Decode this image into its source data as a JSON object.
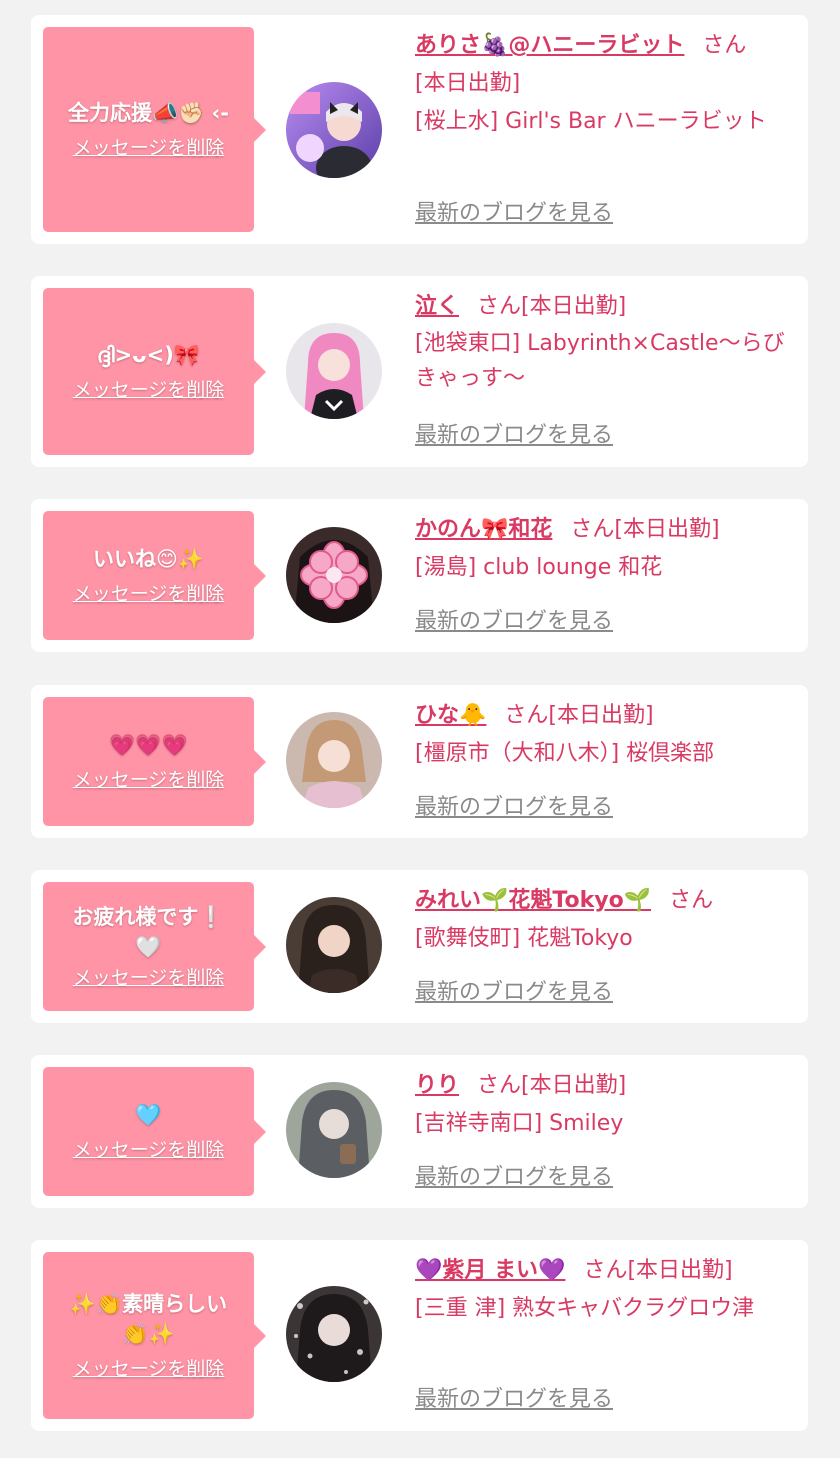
{
  "delete_label": "メッセージを削除",
  "blog_label": "最新のブログを見る",
  "colors": {
    "bubble": "#ff94a6",
    "name": "#d93a63",
    "blog": "#8a8a8a"
  },
  "entries": [
    {
      "message": "全力応援📣✊🏻 ‹-",
      "name": "ありさ🍇@ハニーラビット",
      "san": "さん",
      "line1": "[本日出勤]",
      "line2": "[桜上水] Girl's Bar ハニーラビット"
    },
    {
      "message": "ദ്ദി>ᴗ<)🎀",
      "name": "泣く",
      "san": "さん[本日出勤]",
      "line1": "",
      "line2": "[池袋東口] Labyrinth×Castle〜らびきゃっす〜"
    },
    {
      "message": "いいね😊✨",
      "name": "かのん🎀和花",
      "san": "さん[本日出勤]",
      "line1": "",
      "line2": "[湯島] club lounge 和花"
    },
    {
      "message": "💗💗💗",
      "name": "ひな🐥",
      "san": "さん[本日出勤]",
      "line1": "",
      "line2": "[橿原市（大和八木）] 桜倶楽部"
    },
    {
      "message": "お疲れ様です❕🤍",
      "name": "みれい🌱花魁Tokyo🌱",
      "san": "さん",
      "line1": "",
      "line2": "[歌舞伎町] 花魁Tokyo"
    },
    {
      "message": "🩵",
      "name": "りり",
      "san": "さん[本日出勤]",
      "line1": "",
      "line2": "[吉祥寺南口] Smiley"
    },
    {
      "message": "✨👏素晴らしい👏✨",
      "name": "💜紫月 まい💜",
      "san": "さん[本日出勤]",
      "line1": "",
      "line2": "[三重 津] 熟女キャバクラグロウ津"
    }
  ]
}
